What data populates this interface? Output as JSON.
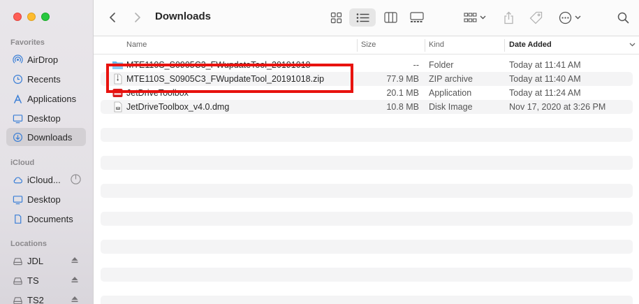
{
  "window": {
    "title": "Downloads"
  },
  "sidebar": {
    "sections": [
      {
        "title": "Favorites",
        "items": [
          {
            "label": "AirDrop",
            "icon": "airdrop-icon"
          },
          {
            "label": "Recents",
            "icon": "clock-icon"
          },
          {
            "label": "Applications",
            "icon": "applications-icon"
          },
          {
            "label": "Desktop",
            "icon": "desktop-icon"
          },
          {
            "label": "Downloads",
            "icon": "downloads-icon",
            "selected": true
          }
        ]
      },
      {
        "title": "iCloud",
        "items": [
          {
            "label": "iCloud...",
            "icon": "cloud-icon"
          },
          {
            "label": "Desktop",
            "icon": "desktop-icon"
          },
          {
            "label": "Documents",
            "icon": "document-icon"
          }
        ]
      },
      {
        "title": "Locations",
        "items": [
          {
            "label": "JDL",
            "icon": "drive-icon"
          },
          {
            "label": "TS",
            "icon": "drive-icon"
          },
          {
            "label": "TS2",
            "icon": "drive-icon"
          }
        ]
      }
    ]
  },
  "columns": {
    "name": "Name",
    "size": "Size",
    "kind": "Kind",
    "date": "Date Added"
  },
  "files": [
    {
      "name": "MTE110S_S0905C3_FWupdateTool_20191018",
      "size": "--",
      "kind": "Folder",
      "date": "Today at 11:41 AM",
      "icon": "folder-icon"
    },
    {
      "name": "MTE110S_S0905C3_FWupdateTool_20191018.zip",
      "size": "77.9 MB",
      "kind": "ZIP archive",
      "date": "Today at 11:40 AM",
      "icon": "zip-icon"
    },
    {
      "name": "JetDriveToolbox",
      "size": "20.1 MB",
      "kind": "Application",
      "date": "Today at 11:24 AM",
      "icon": "app-icon"
    },
    {
      "name": "JetDriveToolbox_v4.0.dmg",
      "size": "10.8 MB",
      "kind": "Disk Image",
      "date": "Nov 17, 2020 at 3:26 PM",
      "icon": "disk-image-icon"
    }
  ],
  "colors": {
    "highlight": "#e8130f",
    "folder": "#5fb4e8",
    "sidebar_bg": "#e6e3e7"
  }
}
